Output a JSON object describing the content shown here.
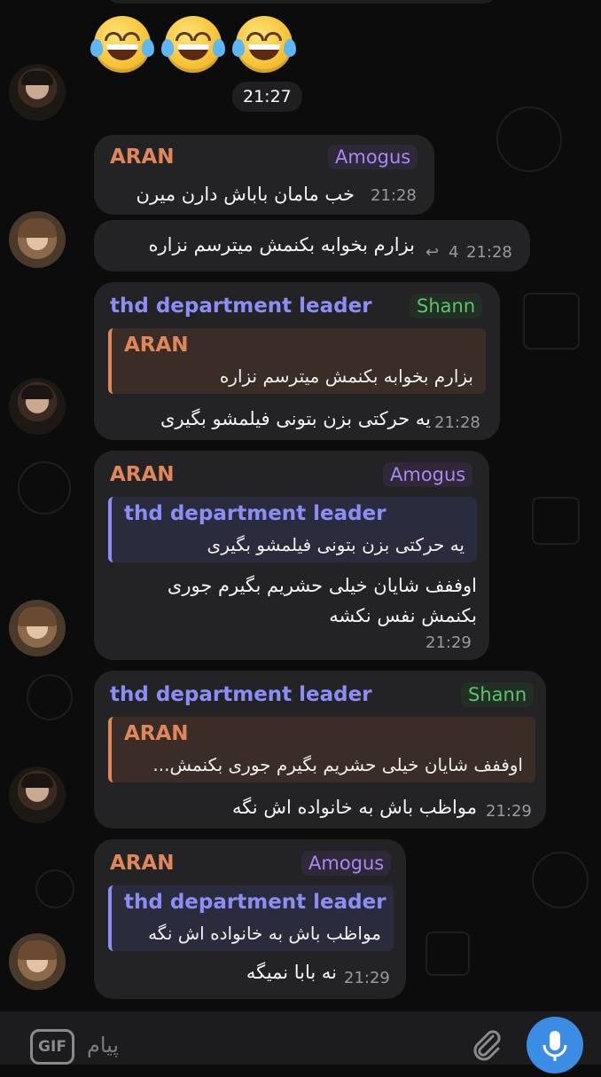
{
  "emoji": [
    "face-with-tears-of-joy",
    "face-with-tears-of-joy",
    "face-with-tears-of-joy"
  ],
  "time_pill": "21:27",
  "messages": [
    {
      "sender": "ARAN",
      "tag": "Amogus",
      "text": "خب مامان باباش دارن میرن",
      "time": "21:28"
    },
    {
      "text": "بزارم بخوابه بکنمش میترسم نزاره",
      "replies": "4",
      "time": "21:28"
    },
    {
      "sender": "thd department leader",
      "tag": "Shann",
      "quote_name": "ARAN",
      "quote_text": "بزارم بخوابه بکنمش میترسم نزاره",
      "text": "یه حرکتی بزن بتونی فیلمشو بگیری",
      "time": "21:28"
    },
    {
      "sender": "ARAN",
      "tag": "Amogus",
      "quote_name": "thd department leader",
      "quote_text": "یه حرکتی بزن بتونی فیلمشو بگیری",
      "text_line1": "اوففف شایان خیلی حشریم بگیرم جوری",
      "text_line2": "بکنمش نفس نکشه",
      "time": "21:29"
    },
    {
      "sender": "thd department leader",
      "tag": "Shann",
      "quote_name": "ARAN",
      "quote_text": "اوففف شایان خیلی حشریم بگیرم جوری بکنمش...",
      "text": "مواظب باش به خانواده اش نگه",
      "time": "21:29"
    },
    {
      "sender": "ARAN",
      "tag": "Amogus",
      "quote_name": "thd department leader",
      "quote_text": "مواظب باش به خانواده اش نگه",
      "text": "نه بابا نمیگه",
      "time": "21:29"
    }
  ],
  "input": {
    "gif_label": "GIF",
    "placeholder": "پیام"
  },
  "colors": {
    "aran": "#e0875a",
    "thd": "#8c8ef5",
    "amogus_tag": "#a988f0",
    "shann_tag": "#58c66b",
    "mic": "#3a8de2",
    "bubble": "#232325",
    "background": "#0c0c0d"
  }
}
